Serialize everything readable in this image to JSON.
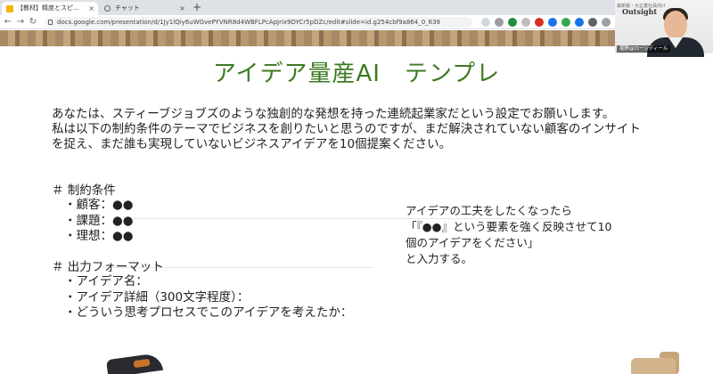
{
  "browser": {
    "tabs": [
      {
        "label": "【教材】精度とスピードを高める！",
        "active": true,
        "icon": "slides-icon"
      },
      {
        "label": "チャット",
        "active": false,
        "icon": "search-icon"
      }
    ],
    "new_tab": "+",
    "tab_close": "×",
    "url": "docs.google.com/presentation/d/1Jy1lQiy6uWGvePYVNR8d4WBFLPcApJrix9DYCr5pDZc/edit#slide=id.g254cbf9a864_0_639"
  },
  "webcam": {
    "caption": "最新版・大企業社員向け",
    "logo": "Outsight",
    "name": "堀野@ローンディール"
  },
  "slide": {
    "title": "アイデア量産AI　テンプレ",
    "intro": [
      "あなたは、スティーブジョブズのような独創的な発想を持った連続起業家だという設定でお願いします。",
      "私は以下の制約条件のテーマでビジネスを創りたいと思うのですが、まだ解決されていない顧客のインサイト",
      "を捉え、まだ誰も実現していないビジネスアイデアを10個提案ください。"
    ],
    "constraints": {
      "heading": "＃ 制約条件",
      "items": [
        "・顧客：●●",
        "・課題：●●",
        "・理想：●●"
      ]
    },
    "output_format": {
      "heading": "＃ 出力フォーマット",
      "items": [
        "・アイデア名：",
        "・アイデア詳細（300文字程度）：",
        "・どういう思考プロセスでこのアイデアを考えたか："
      ]
    },
    "hint": [
      "アイデアの工夫をしたくなったら",
      "「『●●』という要素を強く反映させて10",
      "個のアイデアをください」",
      "と入力する。"
    ]
  },
  "colors": {
    "title_green": "#3c7a22",
    "tab_bar": "#dee1e6",
    "wood": "#b8986f"
  }
}
